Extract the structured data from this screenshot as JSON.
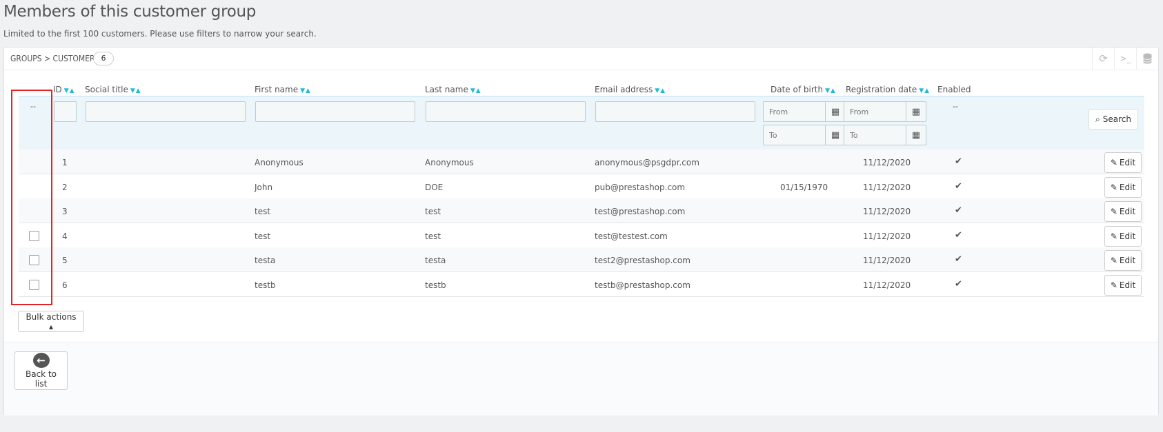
{
  "page": {
    "title": "Members of this customer group",
    "subtitle": "Limited to the first 100 customers. Please use filters to narrow your search."
  },
  "panel": {
    "title": "Groups > Customer",
    "count": "6",
    "toolbar_icons": [
      "refresh-icon",
      "terminal-icon",
      "database-icon"
    ]
  },
  "columns": {
    "id": "ID",
    "social_title": "Social title",
    "first_name": "First name",
    "last_name": "Last name",
    "email": "Email address",
    "dob": "Date of birth",
    "registration": "Registration date",
    "enabled": "Enabled"
  },
  "filters": {
    "bulk_select_value": "--",
    "enabled_value": "--",
    "dob_from_placeholder": "From",
    "dob_to_placeholder": "To",
    "reg_from_placeholder": "From",
    "reg_to_placeholder": "To",
    "search_label": "Search"
  },
  "rows": [
    {
      "id": "1",
      "first_name": "Anonymous",
      "last_name": "Anonymous",
      "email": "anonymous@psgdpr.com",
      "dob": "",
      "registration": "11/12/2020",
      "checkbox": false
    },
    {
      "id": "2",
      "first_name": "John",
      "last_name": "DOE",
      "email": "pub@prestashop.com",
      "dob": "01/15/1970",
      "registration": "11/12/2020",
      "checkbox": false
    },
    {
      "id": "3",
      "first_name": "test",
      "last_name": "test",
      "email": "test@prestashop.com",
      "dob": "",
      "registration": "11/12/2020",
      "checkbox": false
    },
    {
      "id": "4",
      "first_name": "test",
      "last_name": "test",
      "email": "test@testest.com",
      "dob": "",
      "registration": "11/12/2020",
      "checkbox": true
    },
    {
      "id": "5",
      "first_name": "testa",
      "last_name": "testa",
      "email": "test2@prestashop.com",
      "dob": "",
      "registration": "11/12/2020",
      "checkbox": true
    },
    {
      "id": "6",
      "first_name": "testb",
      "last_name": "testb",
      "email": "testb@prestashop.com",
      "dob": "",
      "registration": "11/12/2020",
      "checkbox": true
    }
  ],
  "row_actions": {
    "edit_label": "Edit",
    "enabled_mark": "✔"
  },
  "bulk": {
    "label": "Bulk actions ▴"
  },
  "footer": {
    "back_label": "Back to list"
  },
  "colors": {
    "accent": "#25b9d7",
    "filter_bg": "#ebf5fa",
    "highlight": "#e02424"
  }
}
